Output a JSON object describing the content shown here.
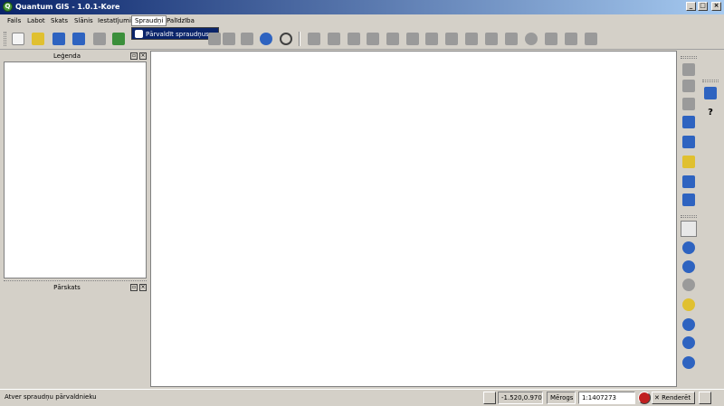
{
  "window": {
    "title": "Quantum GIS - 1.0.1-Kore",
    "minimize_glyph": "_",
    "maximize_glyph": "□",
    "close_glyph": "×"
  },
  "menubar": {
    "items": [
      {
        "label": "Fails"
      },
      {
        "label": "Labot"
      },
      {
        "label": "Skats"
      },
      {
        "label": "Slānis"
      },
      {
        "label": "Iestatījumi"
      },
      {
        "label": "Spraudņi"
      },
      {
        "label": "Palīdzība"
      }
    ]
  },
  "dropdown": {
    "item_label": "Pārvaldīt spraudņus..."
  },
  "docks": {
    "legend_title": "Leģenda",
    "overview_title": "Pārskats"
  },
  "status": {
    "message": "Atver spraudņu pārvaldnieku",
    "coords": "-1.520,0.970",
    "scale_label": "Mērogs",
    "scale_value": "1:1407273",
    "render_label": "Renderēt"
  },
  "colors": {
    "titlebar_start": "#0a246a",
    "titlebar_end": "#a6caf0",
    "menu_highlight": "#0a246a"
  }
}
